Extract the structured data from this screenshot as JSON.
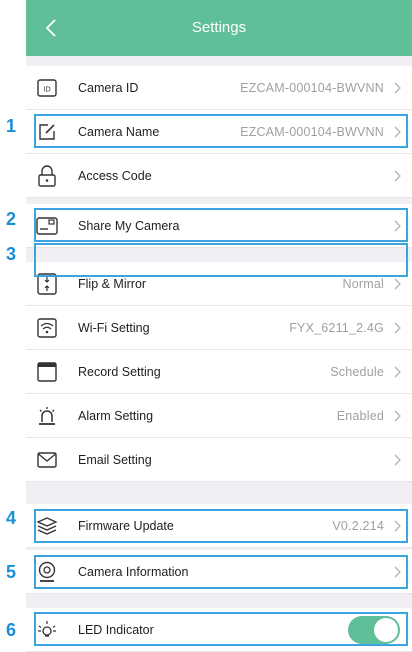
{
  "header": {
    "title": "Settings"
  },
  "rows": [
    {
      "label": "Camera ID",
      "value": "EZCAM-000104-BWVNN"
    },
    {
      "label": "Camera Name",
      "value": "EZCAM-000104-BWVNN"
    },
    {
      "label": "Access Code",
      "value": ""
    },
    {
      "label": "Share My Camera",
      "value": ""
    },
    {
      "label": "Flip & Mirror",
      "value": "Normal"
    },
    {
      "label": "Wi-Fi Setting",
      "value": "FYX_6211_2.4G"
    },
    {
      "label": "Record Setting",
      "value": "Schedule"
    },
    {
      "label": "Alarm Setting",
      "value": "Enabled"
    },
    {
      "label": "Email Setting",
      "value": ""
    },
    {
      "label": "Firmware Update",
      "value": "V0.2.214"
    },
    {
      "label": "Camera Information",
      "value": ""
    },
    {
      "label": "LED Indicator",
      "value": ""
    }
  ],
  "led_indicator": {
    "enabled": true
  },
  "markers": [
    "1",
    "2",
    "3",
    "4",
    "5",
    "6"
  ],
  "colors": {
    "header": "#5fbf98",
    "highlight": "#3aa3e0",
    "marker": "#1a8fd6",
    "toggle_on": "#5fbf98"
  },
  "icons": [
    "id-card-icon",
    "edit-icon",
    "lock-icon",
    "share-icon",
    "flip-icon",
    "wifi-icon",
    "record-icon",
    "alarm-icon",
    "email-icon",
    "firmware-icon",
    "camera-icon",
    "led-icon"
  ]
}
